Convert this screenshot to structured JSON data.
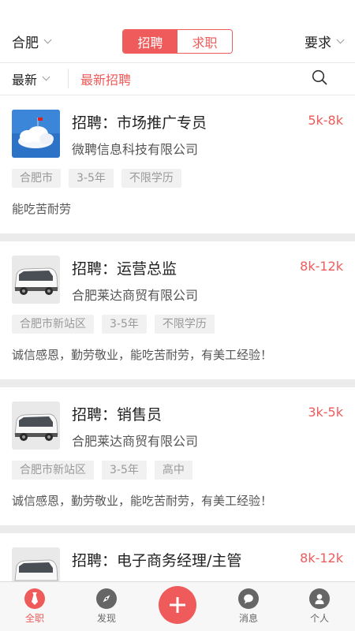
{
  "header": {
    "city": "合肥",
    "segment": {
      "active": "招聘",
      "inactive": "求职"
    },
    "requirement": "要求"
  },
  "filter": {
    "sort": "最新",
    "section": "最新招聘"
  },
  "jobs": [
    {
      "title": "招聘：市场推广专员",
      "salary": "5k-8k",
      "company": "微聘信息科技有限公司",
      "tags": [
        "合肥市",
        "3-5年",
        "不限学历"
      ],
      "desc": "能吃苦耐劳",
      "thumb": "cloud-flag-image"
    },
    {
      "title": "招聘：运营总监",
      "salary": "8k-12k",
      "company": "合肥莱达商贸有限公司",
      "tags": [
        "合肥市新站区",
        "3-5年",
        "不限学历"
      ],
      "desc": "诚信感恩，勤劳敬业，能吃苦耐劳，有美工经验！",
      "thumb": "van-image"
    },
    {
      "title": "招聘：销售员",
      "salary": "3k-5k",
      "company": "合肥莱达商贸有限公司",
      "tags": [
        "合肥市新站区",
        "3-5年",
        "高中"
      ],
      "desc": "诚信感恩，勤劳敬业，能吃苦耐劳，有美工经验！",
      "thumb": "van-image"
    },
    {
      "title": "招聘：电子商务经理/主管",
      "salary": "8k-12k",
      "company": "",
      "tags": [],
      "desc": "",
      "thumb": "van-image"
    }
  ],
  "tabbar": [
    {
      "label": "全职",
      "icon": "tie-icon",
      "active": true
    },
    {
      "label": "发现",
      "icon": "compass-icon",
      "active": false
    },
    {
      "label": "",
      "icon": "plus-icon",
      "active": false
    },
    {
      "label": "消息",
      "icon": "chat-icon",
      "active": false
    },
    {
      "label": "个人",
      "icon": "person-icon",
      "active": false
    }
  ],
  "colors": {
    "accent": "#ef5a5a",
    "tab_icon": "#666666",
    "background": "#ebebeb"
  }
}
